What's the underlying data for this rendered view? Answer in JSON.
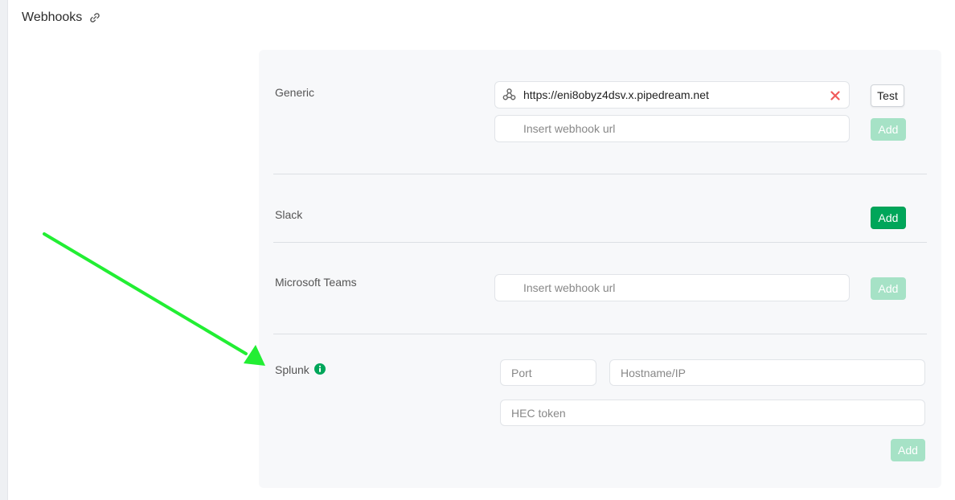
{
  "header": {
    "title": "Webhooks",
    "link_icon": "link-icon"
  },
  "colors": {
    "accent_green": "#00a65a",
    "disabled_green": "#a6e2c6",
    "remove_red": "#f05a5a",
    "annotation_arrow": "#22ee33"
  },
  "generic": {
    "label": "Generic",
    "existing_url": "https://eni8obyz4dsv.x.pipedream.net",
    "placeholder": "Insert webhook url",
    "test_label": "Test",
    "add_label": "Add"
  },
  "slack": {
    "label": "Slack",
    "add_label": "Add"
  },
  "teams": {
    "label": "Microsoft Teams",
    "placeholder": "Insert webhook url",
    "add_label": "Add"
  },
  "splunk": {
    "label": "Splunk",
    "port_placeholder": "Port",
    "host_placeholder": "Hostname/IP",
    "token_placeholder": "HEC token",
    "add_label": "Add"
  }
}
